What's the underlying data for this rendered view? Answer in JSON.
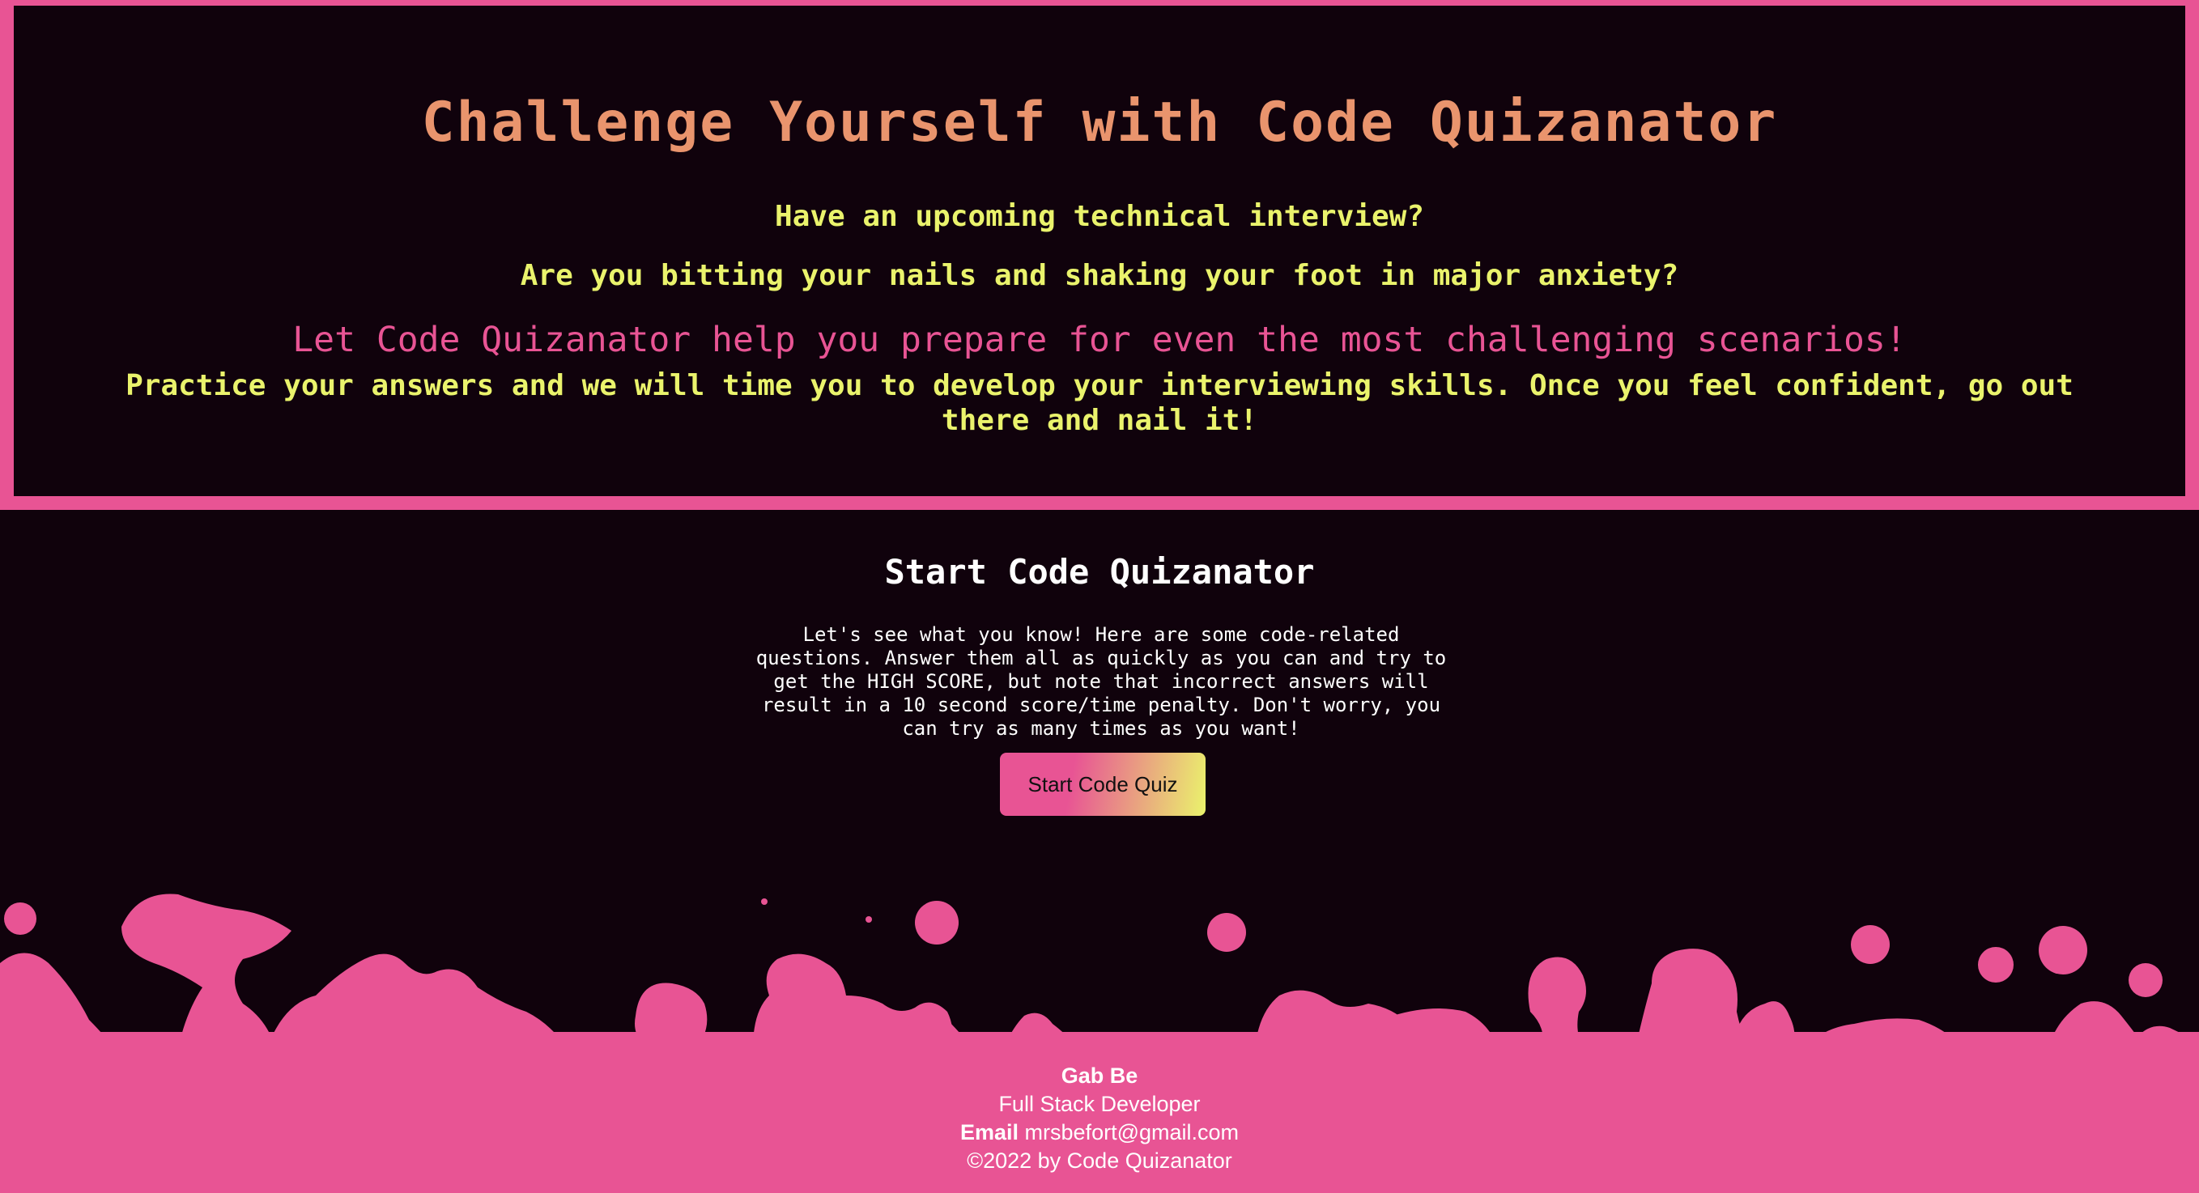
{
  "hero": {
    "title": "Challenge Yourself with Code Quizanator",
    "question_1": "Have an upcoming technical interview?",
    "question_2": "Are you bitting your nails and shaking your foot in major anxiety?",
    "pitch": "Let Code Quizanator help you prepare for even the most challenging scenarios!",
    "practice": "Practice your answers and we will time you to develop your interviewing skills. Once you feel confident, go out there and nail it!"
  },
  "start": {
    "title": "Start Code Quizanator",
    "description": "Let's see what you know! Here are some code-related questions. Answer them all as quickly as you can and try to get the HIGH SCORE, but note that incorrect answers will result in a 10 second score/time penalty. Don't worry, you can try as many times as you want!",
    "button_label": "Start Code Quiz"
  },
  "footer": {
    "name": "Gab Be",
    "role": "Full Stack Developer",
    "email_label": "Email",
    "email": "mrsbefort@gmail.com",
    "copyright": "©2022 by Code Quizanator"
  },
  "colors": {
    "background": "#10020c",
    "pink": "#e85494",
    "yellow": "#eaf36c",
    "peach": "#e9946d"
  }
}
